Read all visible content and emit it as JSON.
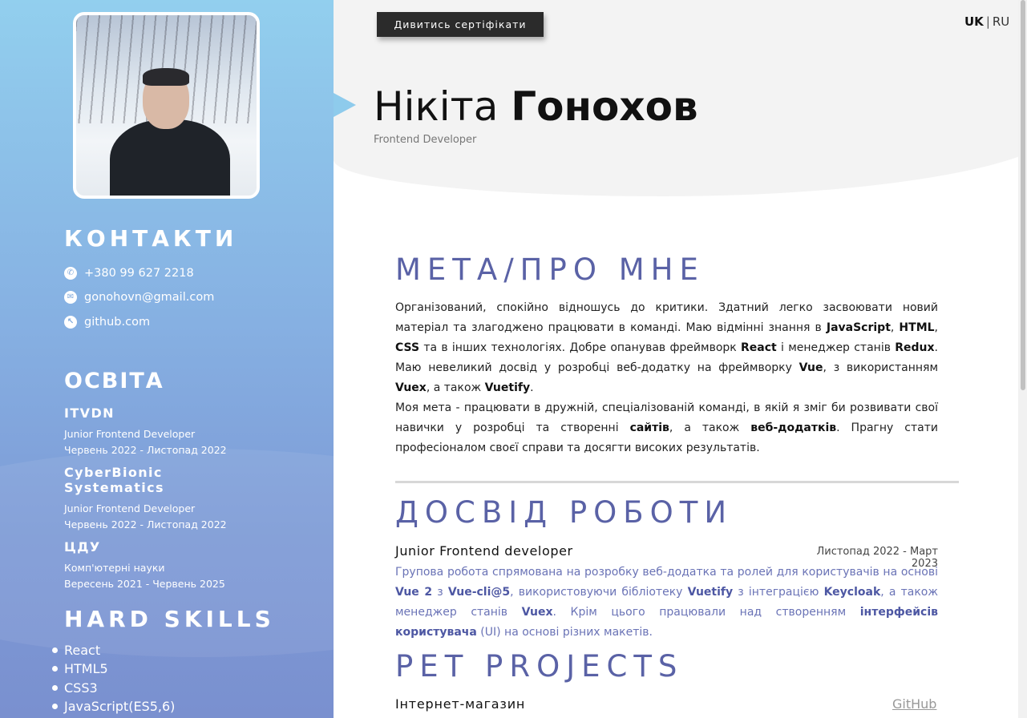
{
  "sidebar": {
    "photo_alt": "Фото профілю",
    "contacts_heading": "КОНТАКТИ",
    "contacts": [
      {
        "icon": "phone-icon",
        "text": "+380 99 627 2218"
      },
      {
        "icon": "mail-icon",
        "text": "gonohovn@gmail.com"
      },
      {
        "icon": "github-icon",
        "text": "github.com"
      }
    ],
    "education_heading": "ОСВІТА",
    "education": [
      {
        "school": "ITVDN",
        "course": "Junior Frontend Developer",
        "period": "Червень 2022 - Листопад 2022"
      },
      {
        "school": "CyberBionic Systematics",
        "course": "Junior Frontend Developer",
        "period": "Червень 2022 - Листопад 2022"
      },
      {
        "school": "ЦДУ",
        "course": "Комп'ютерні науки",
        "period": "Вересень 2021 - Червень 2025"
      }
    ],
    "skills_heading": "HARD SKILLS",
    "skills": [
      "React",
      "HTML5",
      "CSS3",
      "JavaScript(ES5,6)"
    ]
  },
  "header": {
    "cert_button": "Дивитись сертіфікати",
    "lang_active": "UK",
    "lang_separator": "|",
    "lang_other": "RU",
    "first_name": "Нікіта",
    "last_name": "Гонохов",
    "role": "Frontend Developer"
  },
  "about": {
    "title": "МЕТА/ПРО МНЕ",
    "p1": [
      "Організований, спокійно відношусь до критики. Здатний легко засвоювати новий матеріал та злагоджено працювати в команді. Маю відмінні знання в ",
      "JavaScript",
      ", ",
      "HTML",
      ", ",
      "CSS",
      " та в інших технологіях. Добре опанував фреймворк ",
      "React",
      " і менеджер станів ",
      "Redux",
      ". Маю невеликий досвід у розробці веб-додатку на фреймворку ",
      "Vue",
      ", з використанням ",
      "Vuex",
      ", а також ",
      "Vuetify",
      "."
    ],
    "p2": [
      "Моя мета - працювати в дружній, спеціалізованій команді, в якій я зміг би розвивати свої навички у розробці та створенні ",
      "сайтів",
      ", а також ",
      "веб-додатків",
      ". Прагну стати професіоналом своєї справи та досягти високих результатів."
    ]
  },
  "experience": {
    "title": "ДОСВІД РОБОТИ",
    "job_title": "Junior Frontend developer",
    "job_period": "Листопад 2022 - Март 2023",
    "desc": [
      "Групова робота спрямована на розробку веб-додатка та ролей для користувачів на основі ",
      "Vue 2",
      " з ",
      "Vue-cli@5",
      ", використовуючи бібліотеку ",
      "Vuetify",
      " з інтеграцією ",
      "Keycloak",
      ", а також менеджер станів ",
      "Vuex",
      ". Крім цього працювали над створенням ",
      "інтерфейсів користувача",
      " (UI) на основі різних макетів."
    ]
  },
  "projects": {
    "title": "PET PROJECTS",
    "items": [
      {
        "name": "Інтернет-магазин",
        "link": "GitHub"
      }
    ]
  }
}
